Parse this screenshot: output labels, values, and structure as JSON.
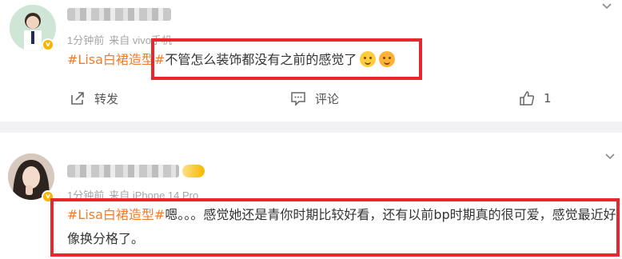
{
  "posts": [
    {
      "time": "1分钟前",
      "source": "来自 vivo手机",
      "tag": "#Lisa白裙造型#",
      "text": "不管怎么装饰都没有之前的感觉了",
      "actions": {
        "repost_label": "转发",
        "comment_label": "评论",
        "like_count": "1"
      }
    },
    {
      "time": "1分钟前",
      "source": "来自 iPhone 14 Pro",
      "tag": "#Lisa白裙造型#",
      "text": "嗯。。。感觉她还是青你时期比较好看，还有以前bp时期真的很可爱，感觉最近好像换分格了。"
    }
  ],
  "colors": {
    "tag": "#f47c2a",
    "highlight_box": "#e8262d",
    "meta_text": "#a5a5a5",
    "verified_badge": "#f7b500"
  },
  "icons": [
    "share-icon",
    "comment-icon",
    "thumbs-up-icon",
    "chevron-down-icon",
    "verified-badge-icon",
    "emoji-icon"
  ]
}
